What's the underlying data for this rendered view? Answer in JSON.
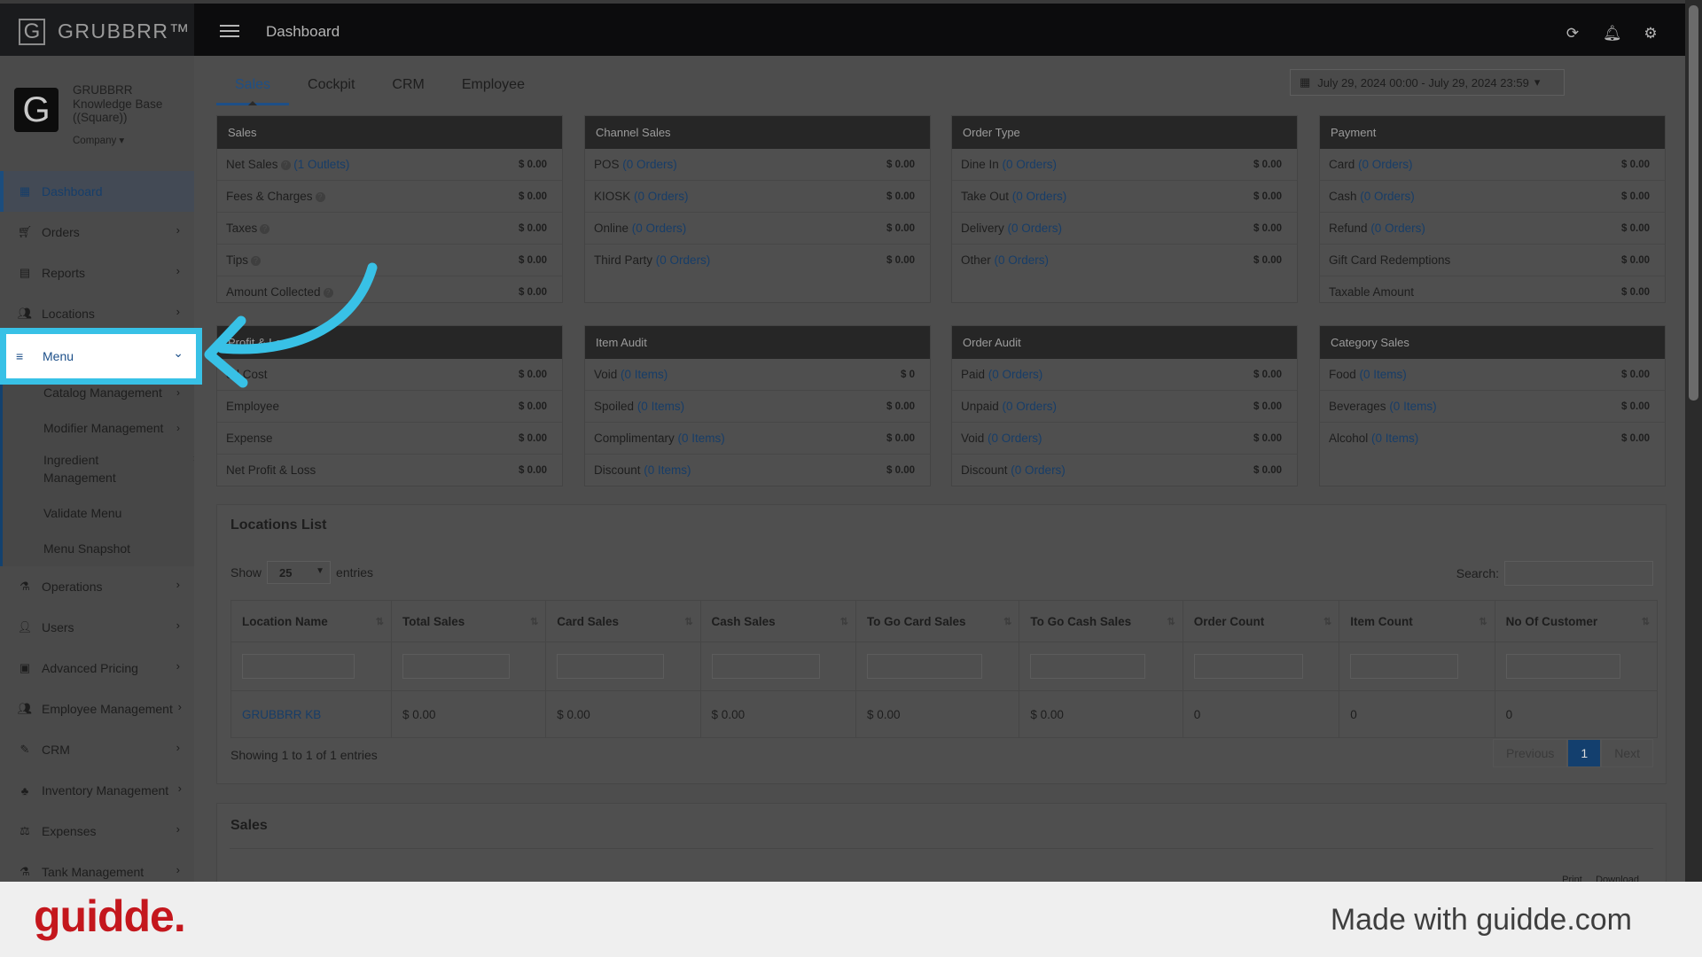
{
  "app": {
    "brand": "GRUBBRR™",
    "breadcrumb": "Dashboard"
  },
  "profile": {
    "logo_letter": "G",
    "name": "GRUBBRR Knowledge Base ((Square))",
    "company_label": "Company"
  },
  "sidebar": {
    "items": [
      {
        "label": "Dashboard",
        "icon": "grid-icon"
      },
      {
        "label": "Orders",
        "icon": "cart-icon"
      },
      {
        "label": "Reports",
        "icon": "report-icon"
      },
      {
        "label": "Locations",
        "icon": "group-icon"
      },
      {
        "label": "Menu",
        "icon": "list-icon"
      },
      {
        "label": "Operations",
        "icon": "flask-icon"
      },
      {
        "label": "Users",
        "icon": "user-add-icon"
      },
      {
        "label": "Advanced Pricing",
        "icon": "money-icon"
      },
      {
        "label": "Employee Management",
        "icon": "group-icon"
      },
      {
        "label": "CRM",
        "icon": "wrench-icon"
      },
      {
        "label": "Inventory Management",
        "icon": "sitemap-icon"
      },
      {
        "label": "Expenses",
        "icon": "scale-icon"
      },
      {
        "label": "Tank Management",
        "icon": "flask-icon"
      }
    ],
    "submenu": [
      {
        "label": "Catalog Management"
      },
      {
        "label": "Modifier Management"
      },
      {
        "label": "Ingredient Management"
      },
      {
        "label": "Validate Menu"
      },
      {
        "label": "Menu Snapshot"
      }
    ]
  },
  "tabs": [
    "Sales",
    "Cockpit",
    "CRM",
    "Employee"
  ],
  "date_range": "July 29, 2024 00:00 - July 29, 2024 23:59",
  "cards": {
    "sales": {
      "title": "Sales",
      "rows": [
        {
          "label": "Net Sales",
          "link": "(1 Outlets)",
          "value": "$ 0.00"
        },
        {
          "label": "Fees & Charges",
          "value": "$ 0.00"
        },
        {
          "label": "Taxes",
          "value": "$ 0.00"
        },
        {
          "label": "Tips",
          "value": "$ 0.00"
        },
        {
          "label": "Amount Collected",
          "value": "$ 0.00"
        }
      ]
    },
    "channel": {
      "title": "Channel Sales",
      "rows": [
        {
          "label": "POS",
          "link": "(0 Orders)",
          "value": "$ 0.00"
        },
        {
          "label": "KIOSK",
          "link": "(0 Orders)",
          "value": "$ 0.00"
        },
        {
          "label": "Online",
          "link": "(0 Orders)",
          "value": "$ 0.00"
        },
        {
          "label": "Third Party",
          "link": "(0 Orders)",
          "value": "$ 0.00"
        }
      ]
    },
    "ordertype": {
      "title": "Order Type",
      "rows": [
        {
          "label": "Dine In",
          "link": "(0 Orders)",
          "value": "$ 0.00"
        },
        {
          "label": "Take Out",
          "link": "(0 Orders)",
          "value": "$ 0.00"
        },
        {
          "label": "Delivery",
          "link": "(0 Orders)",
          "value": "$ 0.00"
        },
        {
          "label": "Other",
          "link": "(0 Orders)",
          "value": "$ 0.00"
        }
      ]
    },
    "payment": {
      "title": "Payment",
      "rows": [
        {
          "label": "Card",
          "link": "(0 Orders)",
          "value": "$ 0.00"
        },
        {
          "label": "Cash",
          "link": "(0 Orders)",
          "value": "$ 0.00"
        },
        {
          "label": "Refund",
          "link": "(0 Orders)",
          "value": "$ 0.00"
        },
        {
          "label": "Gift Card Redemptions",
          "value": "$ 0.00"
        },
        {
          "label": "Taxable Amount",
          "value": "$ 0.00"
        }
      ]
    },
    "profit": {
      "title": "Profit & Lo",
      "rows": [
        {
          "label": "od Cost",
          "value": "$ 0.00"
        },
        {
          "label": "Employee",
          "value": "$ 0.00"
        },
        {
          "label": "Expense",
          "value": "$ 0.00"
        },
        {
          "label": "Net Profit & Loss",
          "value": "$ 0.00"
        }
      ]
    },
    "itemaudit": {
      "title": "Item Audit",
      "rows": [
        {
          "label": "Void",
          "link": "(0 Items)",
          "value": "$ 0"
        },
        {
          "label": "Spoiled",
          "link": "(0 Items)",
          "value": "$ 0.00"
        },
        {
          "label": "Complimentary",
          "link": "(0 Items)",
          "value": "$ 0.00"
        },
        {
          "label": "Discount",
          "link": "(0 Items)",
          "value": "$ 0.00"
        }
      ]
    },
    "orderaudit": {
      "title": "Order Audit",
      "rows": [
        {
          "label": "Paid",
          "link": "(0 Orders)",
          "value": "$ 0.00"
        },
        {
          "label": "Unpaid",
          "link": "(0 Orders)",
          "value": "$ 0.00"
        },
        {
          "label": "Void",
          "link": "(0 Orders)",
          "value": "$ 0.00"
        },
        {
          "label": "Discount",
          "link": "(0 Orders)",
          "value": "$ 0.00"
        }
      ]
    },
    "category": {
      "title": "Category Sales",
      "rows": [
        {
          "label": "Food",
          "link": "(0 Items)",
          "value": "$ 0.00"
        },
        {
          "label": "Beverages",
          "link": "(0 Items)",
          "value": "$ 0.00"
        },
        {
          "label": "Alcohol",
          "link": "(0 Items)",
          "value": "$ 0.00"
        }
      ]
    }
  },
  "locations": {
    "title": "Locations List",
    "show_label": "Show",
    "entries_value": "25",
    "entries_label": "entries",
    "search_label": "Search:",
    "columns": [
      "Location Name",
      "Total Sales",
      "Card Sales",
      "Cash Sales",
      "To Go Card Sales",
      "To Go Cash Sales",
      "Order Count",
      "Item Count",
      "No Of Customer"
    ],
    "rows": [
      [
        "GRUBBRR KB",
        "$ 0.00",
        "$ 0.00",
        "$ 0.00",
        "$ 0.00",
        "$ 0.00",
        "0",
        "0",
        "0"
      ]
    ],
    "showing": "Showing 1 to 1 of 1 entries",
    "pager": {
      "prev": "Previous",
      "current": "1",
      "next": "Next"
    }
  },
  "sales_panel": {
    "title": "Sales",
    "print": "Print",
    "download": "Download"
  },
  "footer": {
    "logo": "guidde.",
    "tagline": "Made with guidde.com"
  },
  "colors": {
    "highlight": "#38c1e6",
    "link": "#173d68",
    "guidde_red": "#c4171d"
  }
}
